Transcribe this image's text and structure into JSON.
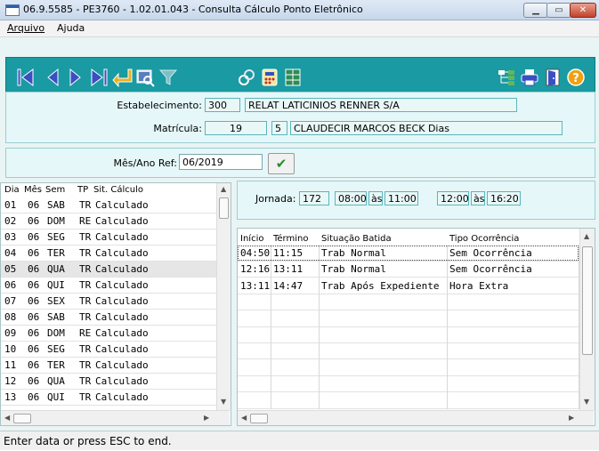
{
  "window": {
    "title": "06.9.5585 - PE3760 - 1.02.01.043 - Consulta Cálculo Ponto Eletrônico",
    "minimize_glyph": "▁",
    "maximize_glyph": "▭",
    "close_glyph": "✕"
  },
  "menu": {
    "file": "Arquivo",
    "help": "Ajuda"
  },
  "toolbar": {
    "icons": [
      "first-record-icon",
      "previous-record-icon",
      "next-record-icon",
      "last-record-icon",
      "enter-icon",
      "preview-icon",
      "filter-icon",
      "links-icon",
      "calculator-icon",
      "spreadsheet-icon",
      "tree-icon",
      "print-icon",
      "exit-door-icon",
      "help-icon"
    ],
    "colors": {
      "background": "#1a9aa2",
      "nav": "#3a4fc2",
      "enter": "#e8b020",
      "help": "#f0a010"
    }
  },
  "header": {
    "establishment_label": "Estabelecimento:",
    "establishment_code": "300",
    "establishment_name": "RELAT LATICINIOS RENNER S/A",
    "registration_label": "Matrícula:",
    "registration_number": "19",
    "registration_digit": "5",
    "employee_name": "CLAUDECIR MARCOS BECK Dias",
    "month_label": "Mês/Ano Ref:",
    "month_value": "06/2019",
    "confirm_glyph": "✔"
  },
  "days_table": {
    "columns": [
      "Dia",
      "Mês",
      "Sem",
      "TP",
      "Sit. Cálculo"
    ],
    "rows": [
      [
        "01",
        "06",
        "SAB",
        "TR",
        "Calculado"
      ],
      [
        "02",
        "06",
        "DOM",
        "RE",
        "Calculado"
      ],
      [
        "03",
        "06",
        "SEG",
        "TR",
        "Calculado"
      ],
      [
        "04",
        "06",
        "TER",
        "TR",
        "Calculado"
      ],
      [
        "05",
        "06",
        "QUA",
        "TR",
        "Calculado"
      ],
      [
        "06",
        "06",
        "QUI",
        "TR",
        "Calculado"
      ],
      [
        "07",
        "06",
        "SEX",
        "TR",
        "Calculado"
      ],
      [
        "08",
        "06",
        "SAB",
        "TR",
        "Calculado"
      ],
      [
        "09",
        "06",
        "DOM",
        "RE",
        "Calculado"
      ],
      [
        "10",
        "06",
        "SEG",
        "TR",
        "Calculado"
      ],
      [
        "11",
        "06",
        "TER",
        "TR",
        "Calculado"
      ],
      [
        "12",
        "06",
        "QUA",
        "TR",
        "Calculado"
      ],
      [
        "13",
        "06",
        "QUI",
        "TR",
        "Calculado"
      ]
    ],
    "selected_index": 4
  },
  "journey": {
    "label": "Jornada:",
    "code": "172",
    "start1": "08:00",
    "sep1": "às",
    "end1": "11:00",
    "start2": "12:00",
    "sep2": "às",
    "end2": "16:20"
  },
  "punches_table": {
    "columns": [
      "Início",
      "Término",
      "Situação Batida",
      "Tipo Ocorrência"
    ],
    "rows": [
      [
        "04:50",
        "11:15",
        "Trab Normal",
        "Sem Ocorrência"
      ],
      [
        "12:16",
        "13:11",
        "Trab Normal",
        "Sem Ocorrência"
      ],
      [
        "13:11",
        "14:47",
        "Trab Após Expediente",
        "Hora Extra"
      ]
    ],
    "selected_index": 0
  },
  "status": {
    "text": "Enter data or press ESC to end."
  }
}
